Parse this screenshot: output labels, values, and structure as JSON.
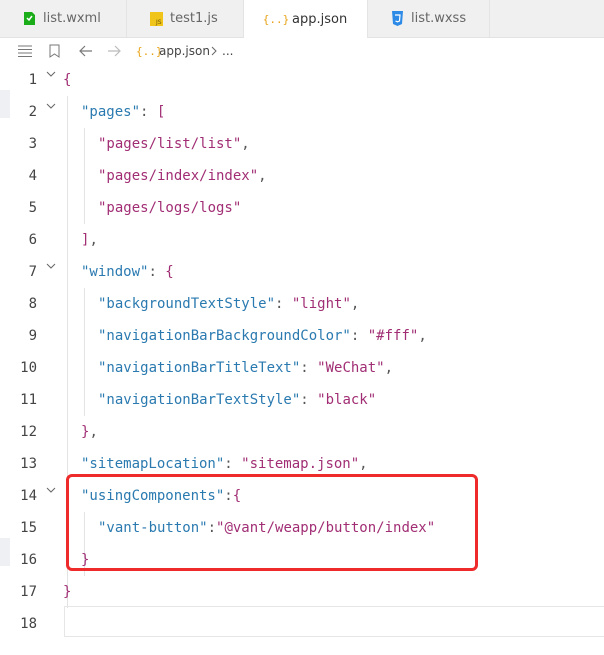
{
  "tabs": [
    {
      "label": "list.wxml",
      "icon": "wxml-file-icon",
      "color": "#1aad19",
      "active": false
    },
    {
      "label": "test1.js",
      "icon": "js-file-icon",
      "color": "#f0c419",
      "active": false
    },
    {
      "label": "app.json",
      "icon": "json-file-icon",
      "color": "#e8a317",
      "active": true
    },
    {
      "label": "list.wxss",
      "icon": "wxss-file-icon",
      "color": "#2d8ae6",
      "active": false
    }
  ],
  "breadcrumb": {
    "file_icon_text": "{..}",
    "file": "app.json",
    "more": "..."
  },
  "line_numbers": [
    "1",
    "2",
    "3",
    "4",
    "5",
    "6",
    "7",
    "8",
    "9",
    "10",
    "11",
    "12",
    "13",
    "14",
    "15",
    "16",
    "17",
    "18"
  ],
  "code": {
    "l1": {
      "brace": "{"
    },
    "l2": {
      "key": "\"pages\"",
      "sep": ": ",
      "open": "["
    },
    "l3": {
      "str": "\"pages/list/list\"",
      "comma": ","
    },
    "l4": {
      "str": "\"pages/index/index\"",
      "comma": ","
    },
    "l5": {
      "str": "\"pages/logs/logs\""
    },
    "l6": {
      "close": "]",
      "comma": ","
    },
    "l7": {
      "key": "\"window\"",
      "sep": ": ",
      "open": "{"
    },
    "l8": {
      "key": "\"backgroundTextStyle\"",
      "sep": ": ",
      "val": "\"light\"",
      "comma": ","
    },
    "l9": {
      "key": "\"navigationBarBackgroundColor\"",
      "sep": ": ",
      "val": "\"#fff\"",
      "comma": ","
    },
    "l10": {
      "key": "\"navigationBarTitleText\"",
      "sep": ": ",
      "val": "\"WeChat\"",
      "comma": ","
    },
    "l11": {
      "key": "\"navigationBarTextStyle\"",
      "sep": ": ",
      "val": "\"black\""
    },
    "l12": {
      "close": "}",
      "comma": ","
    },
    "l13": {
      "key": "\"sitemapLocation\"",
      "sep": ": ",
      "val": "\"sitemap.json\"",
      "comma": ","
    },
    "l14": {
      "key": "\"usingComponents\"",
      "sep": ":",
      "open": "{"
    },
    "l15": {
      "key": "\"vant-button\"",
      "sep": ":",
      "val": "\"@vant/weapp/button/index\""
    },
    "l16": {
      "close": "}"
    },
    "l17": {
      "brace": "}"
    }
  },
  "colors": {
    "key": "#2a7ab0",
    "string": "#a12e74",
    "highlight_box": "#ee2a2a"
  }
}
